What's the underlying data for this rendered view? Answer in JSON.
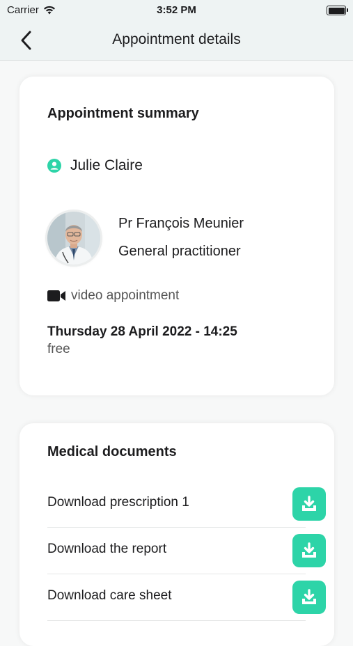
{
  "status_bar": {
    "carrier": "Carrier",
    "time": "3:52 PM"
  },
  "nav": {
    "title": "Appointment details"
  },
  "summary": {
    "title": "Appointment summary",
    "patient_name": "Julie  Claire",
    "doctor_name": "Pr François  Meunier",
    "doctor_specialty": "General practitioner",
    "appointment_type": "video appointment",
    "date_time": "Thursday 28 April 2022 - 14:25",
    "price": "free"
  },
  "documents": {
    "title": "Medical documents",
    "items": [
      {
        "label": "Download prescription 1"
      },
      {
        "label": "Download the report"
      },
      {
        "label": "Download care sheet"
      }
    ]
  },
  "colors": {
    "accent": "#2dd4a8",
    "nav_background": "#eef3f3",
    "page_background": "#f7f8f8"
  }
}
